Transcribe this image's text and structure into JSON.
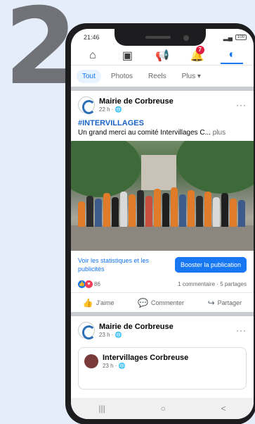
{
  "overlay": {
    "number": "2"
  },
  "status_bar": {
    "time": "21:46",
    "battery": "100"
  },
  "nav": {
    "home_icon": "home-icon",
    "news_icon": "news-icon",
    "announce_icon": "megaphone-icon",
    "notif_icon": "bell-icon",
    "notif_badge": "7",
    "profile_icon": "profile-icon"
  },
  "tabs": [
    "Tout",
    "Photos",
    "Reels",
    "Plus ▾"
  ],
  "post1": {
    "author": "Mairie de Corbreuse",
    "meta": "22 h · 🌐",
    "hashtag": "#INTERVILLAGES",
    "text": "Un grand merci au comité Intervillages C...",
    "more": "plus",
    "stats_link": "Voir les statistiques et les publicités",
    "boost": "Booster la publication",
    "reactions_count": "86",
    "comments": "1 commentaire",
    "shares": "5 partages",
    "like": "J'aime",
    "comment": "Commenter",
    "share": "Partager"
  },
  "post2": {
    "author": "Mairie de Corbreuse",
    "meta": "23 h · 🌐",
    "shared_author": "Intervillages Corbreuse",
    "shared_meta": "23 h · 🌐"
  },
  "system_nav": {
    "recents": "|||",
    "home": "○",
    "back": "<"
  },
  "colors": {
    "accent": "#1877f2",
    "hashtag": "#1a63c5",
    "badge": "#e41e3f"
  }
}
